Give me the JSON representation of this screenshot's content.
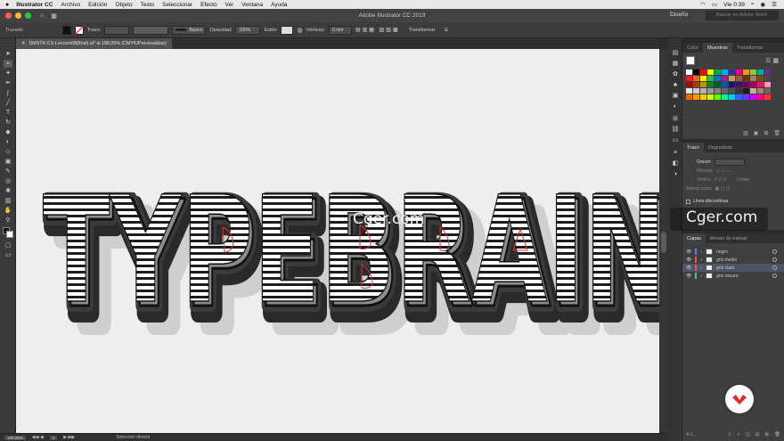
{
  "menubar": {
    "apple_icon": "apple-icon",
    "items": [
      "Illustrator CC",
      "Archivo",
      "Edición",
      "Objeto",
      "Texto",
      "Seleccionar",
      "Efecto",
      "Ver",
      "Ventana",
      "Ayuda"
    ],
    "time": "Vie 0:39"
  },
  "appbar": {
    "title": "Adobe Illustrator CC 2019",
    "workspace": "Diseño",
    "search_placeholder": "Buscar en Adobe Stock"
  },
  "control_bar": {
    "label": "Trazado",
    "stroke_label": "Trazo:",
    "brush_value": "Básico",
    "opacity_label": "Opacidad:",
    "opacity_value": "100%",
    "style_label": "Estilo:",
    "vertices_label": "Vértices:",
    "vertices_value": "0 mm",
    "transform_label": "Transformar"
  },
  "document": {
    "tab_title": "DMSTK-CS-Leccion08(final).ai* al 188,05% (CMYK/Previsualizar)"
  },
  "artwork": {
    "text": "TYPEBRAIN",
    "watermark": "Cger.com"
  },
  "status": {
    "zoom": "188,05%",
    "artboard": "1",
    "tool": "Selección directa"
  },
  "color_panel": {
    "tabs": [
      "Color",
      "Muestras",
      "Transformar"
    ],
    "active": "Muestras",
    "swatches": [
      "#ffffff",
      "#000000",
      "#ff0000",
      "#ffff00",
      "#00a651",
      "#00aeef",
      "#2e3192",
      "#ec008c",
      "#f7941d",
      "#8dc63f",
      "#00a99d",
      "#662d91",
      "#ed1c24",
      "#f26522",
      "#fff200",
      "#39b54a",
      "#0072bc",
      "#92278f",
      "#c69c6d",
      "#8c6239",
      "#603913",
      "#a67c52",
      "#754c24",
      "#534741",
      "#9e0b0f",
      "#a0410d",
      "#aba000",
      "#197b30",
      "#005826",
      "#0054a6",
      "#1b1464",
      "#440e62",
      "#630460",
      "#9e005d",
      "#ed145b",
      "#f49ac1",
      "#e6e6e6",
      "#cccccc",
      "#b3b3b3",
      "#999999",
      "#808080",
      "#666666",
      "#4d4d4d",
      "#333333",
      "#1a1a1a",
      "#c7b299",
      "#998675",
      "#736357",
      "#ff6600",
      "#ff9900",
      "#ffcc00",
      "#ccff00",
      "#66ff00",
      "#00ff99",
      "#00ccff",
      "#3366ff",
      "#6633ff",
      "#cc00ff",
      "#ff0099",
      "#ff3333"
    ]
  },
  "stroke_panel": {
    "tabs": [
      "Trazo",
      "Degradado"
    ],
    "active": "Trazo",
    "weight_label": "Grosor:",
    "remate_label": "Remate:",
    "vertices_label": "Vértice:",
    "limit_label": "Límite:",
    "align_label": "Alinear trazo:",
    "dashed_label": "Línea discontinua"
  },
  "layers_panel": {
    "tabs": [
      "Capas",
      "Mesas de trabajo"
    ],
    "active": "Capas",
    "layers": [
      {
        "name": "negro",
        "color": "#4f7fff"
      },
      {
        "name": "gris medio",
        "color": "#ff4f4f"
      },
      {
        "name": "gris claro",
        "color": "#ff4f4f"
      },
      {
        "name": "gris oscuro",
        "color": "#4fd05a"
      }
    ],
    "footer_count": "4 c..."
  },
  "overlay_watermark": "Cger.com"
}
